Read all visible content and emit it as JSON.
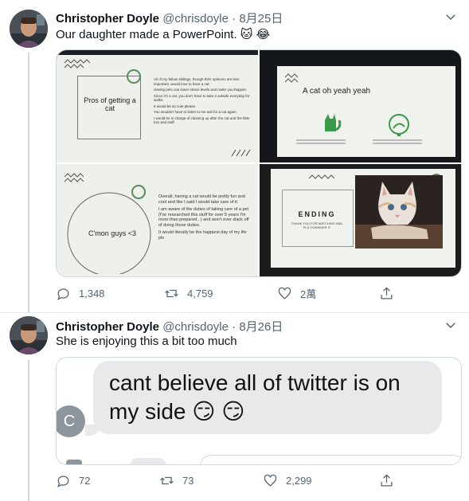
{
  "tweets": [
    {
      "author": {
        "name": "Christopher Doyle",
        "handle": "@chrisdoyle",
        "date": "8月25日"
      },
      "text": "Our daughter made a PowerPoint. 🐱 😂",
      "slides": {
        "pros": {
          "title": "Pros of getting a cat",
          "bullets": [
            "All of my fellow siblings, though their opinions are less important, would love to have a cat.",
            "Having pets can lower stress levels and make you happier.",
            "Since it's a cat, you don't have to take it outside everyday for walks.",
            "It would be so cute please.",
            "You wouldn't have to listen to me ask for a cat again.",
            "I would be in charge of cleaning up after the cat and the litter box and stuff."
          ]
        },
        "cat_slide": {
          "title": "A cat oh yeah yeah"
        },
        "cmon": {
          "title": "C'mon guys <3",
          "bullets": [
            "Overall, having a cat would be pretty fun and cool and like I said I would take care of it.",
            "I am aware of the duties of taking care of a pet (I've researched this stuff for over 5 years I'm more than prepared...) and won't ever slack off of doing those duties.",
            "It would literally be the happiest day of my life pls"
          ]
        },
        "ending": {
          "title": "ENDING",
          "subtitle": "THANK YOU FOR WATCHING AND PLS CONSIDER IT"
        }
      },
      "stats": {
        "replies": "1,348",
        "retweets": "4,759",
        "likes": "2萬"
      }
    },
    {
      "author": {
        "name": "Christopher Doyle",
        "handle": "@chrisdoyle",
        "date": "8月26日"
      },
      "text": "She is enjoying this a bit too much",
      "message": {
        "avatar_initial": "C",
        "text": "cant believe all of twitter is on my side 😏 😏"
      },
      "stats": {
        "replies": "72",
        "retweets": "73",
        "likes": "2,299"
      }
    }
  ],
  "colors": {
    "secondary": "#536471",
    "border": "#cfd9de",
    "bubble": "#e9e9eb",
    "slide_bg": "#f3f5f2",
    "green": "#3a9a4a"
  }
}
